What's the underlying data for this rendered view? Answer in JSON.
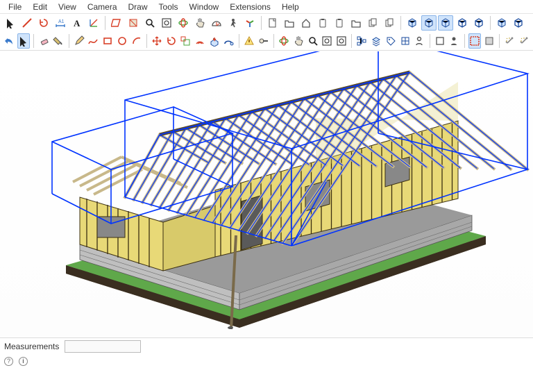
{
  "menubar": {
    "items": [
      "File",
      "Edit",
      "View",
      "Camera",
      "Draw",
      "Tools",
      "Window",
      "Extensions",
      "Help"
    ]
  },
  "statusbar": {
    "measurements_label": "Measurements",
    "measurements_value": ""
  },
  "colors": {
    "stroke_red": "#d84028",
    "stroke_blue": "#3a7acb",
    "stroke_green": "#4aa33a",
    "stroke_navy": "#1a4b9e",
    "stroke_black": "#222",
    "stroke_gray": "#555",
    "selection_blue": "#0033ff"
  },
  "toolbar_rows": [
    [
      {
        "name": "select-icon"
      },
      {
        "name": "select-line-icon"
      },
      {
        "name": "rotate-icon"
      },
      {
        "name": "dimension-icon"
      },
      {
        "name": "text-icon"
      },
      {
        "name": "axis-icon"
      },
      {
        "sep": true
      },
      {
        "name": "section-cut-icon"
      },
      {
        "name": "section-fill-icon"
      },
      {
        "name": "zoom-icon"
      },
      {
        "name": "zoom-extent-icon"
      },
      {
        "name": "orbit-icon"
      },
      {
        "name": "pan-icon"
      },
      {
        "name": "protractor-icon"
      },
      {
        "name": "walk-icon"
      },
      {
        "name": "axes-icon"
      },
      {
        "sep": true
      },
      {
        "name": "new-file-icon"
      },
      {
        "name": "open-file-icon"
      },
      {
        "name": "home-icon"
      },
      {
        "name": "paste-place-icon"
      },
      {
        "name": "paste-icon"
      },
      {
        "name": "folder-icon"
      },
      {
        "name": "clipboard-icon"
      },
      {
        "name": "copy-icon"
      },
      {
        "sep": true
      },
      {
        "name": "solid-box-icon"
      },
      {
        "name": "box-view-icon",
        "active": true
      },
      {
        "name": "shaded-icon",
        "active": true
      },
      {
        "name": "wire-box-icon"
      },
      {
        "name": "hidden-box-icon"
      },
      {
        "sep": true
      },
      {
        "name": "cube-shade-icon"
      },
      {
        "name": "cube-wire-icon"
      }
    ],
    [
      {
        "name": "undo-icon"
      },
      {
        "name": "cursor-icon",
        "active": true
      },
      {
        "sep": true
      },
      {
        "name": "eraser-icon"
      },
      {
        "name": "paint-icon"
      },
      {
        "sep": true
      },
      {
        "name": "pencil-icon"
      },
      {
        "name": "freehand-icon"
      },
      {
        "name": "rectangle-icon"
      },
      {
        "name": "circle-icon"
      },
      {
        "name": "arc-icon"
      },
      {
        "sep": true
      },
      {
        "name": "move-tool-icon"
      },
      {
        "name": "rotate-tool-icon"
      },
      {
        "name": "scale-tool-icon"
      },
      {
        "name": "offset-icon"
      },
      {
        "name": "pushpull-icon"
      },
      {
        "name": "followme-icon"
      },
      {
        "sep": true
      },
      {
        "name": "warning-icon"
      },
      {
        "name": "tape-icon"
      },
      {
        "sep": true
      },
      {
        "name": "orbit-nav-icon"
      },
      {
        "name": "pan-nav-icon"
      },
      {
        "name": "zoom-nav-icon"
      },
      {
        "name": "zoom-window-icon"
      },
      {
        "name": "zoom-extents-icon"
      },
      {
        "sep": true
      },
      {
        "name": "outliner-icon"
      },
      {
        "name": "layers-icon"
      },
      {
        "name": "tags-icon"
      },
      {
        "name": "component-icon"
      },
      {
        "name": "person-icon"
      },
      {
        "sep": true
      },
      {
        "name": "wire-rect-icon"
      },
      {
        "name": "avatar-icon"
      },
      {
        "sep": true
      },
      {
        "name": "selection-box-icon",
        "active": true
      },
      {
        "name": "fill-rect-icon"
      },
      {
        "sep": true
      },
      {
        "name": "wand-icon"
      },
      {
        "name": "wand-2-icon"
      }
    ]
  ],
  "viewport": {
    "scene_description": "3D isometric view of timber-framed house on concrete-block foundation with green grass strip and brown soil base; roof rafters exposed; blue wireframe selection box around roof and left wing."
  }
}
